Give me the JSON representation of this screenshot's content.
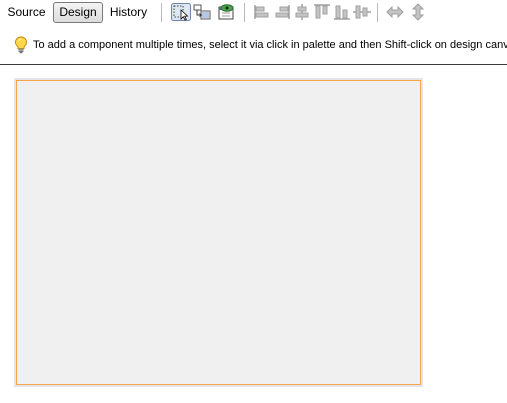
{
  "toolbar": {
    "tabs": [
      {
        "label": "Source",
        "active": false
      },
      {
        "label": "Design",
        "active": true
      },
      {
        "label": "History",
        "active": false
      }
    ],
    "icons": [
      "selection-mode-icon",
      "connection-mode-icon",
      "preview-design-icon",
      "align-left-icon",
      "align-right-icon",
      "center-horizontally-icon",
      "align-top-icon",
      "align-bottom-icon",
      "center-vertically-icon",
      "change-horizontal-resizability-icon",
      "change-vertical-resizability-icon"
    ]
  },
  "hint": {
    "icon": "lightbulb-icon",
    "text": "To add a component multiple times, select it via click in palette and then Shift-click on design canvas"
  },
  "colors": {
    "canvas_background": "#ffffff",
    "form_background": "#f0f0f0",
    "form_border": "#f5a54a",
    "form_frame": "#e4e4ea"
  }
}
